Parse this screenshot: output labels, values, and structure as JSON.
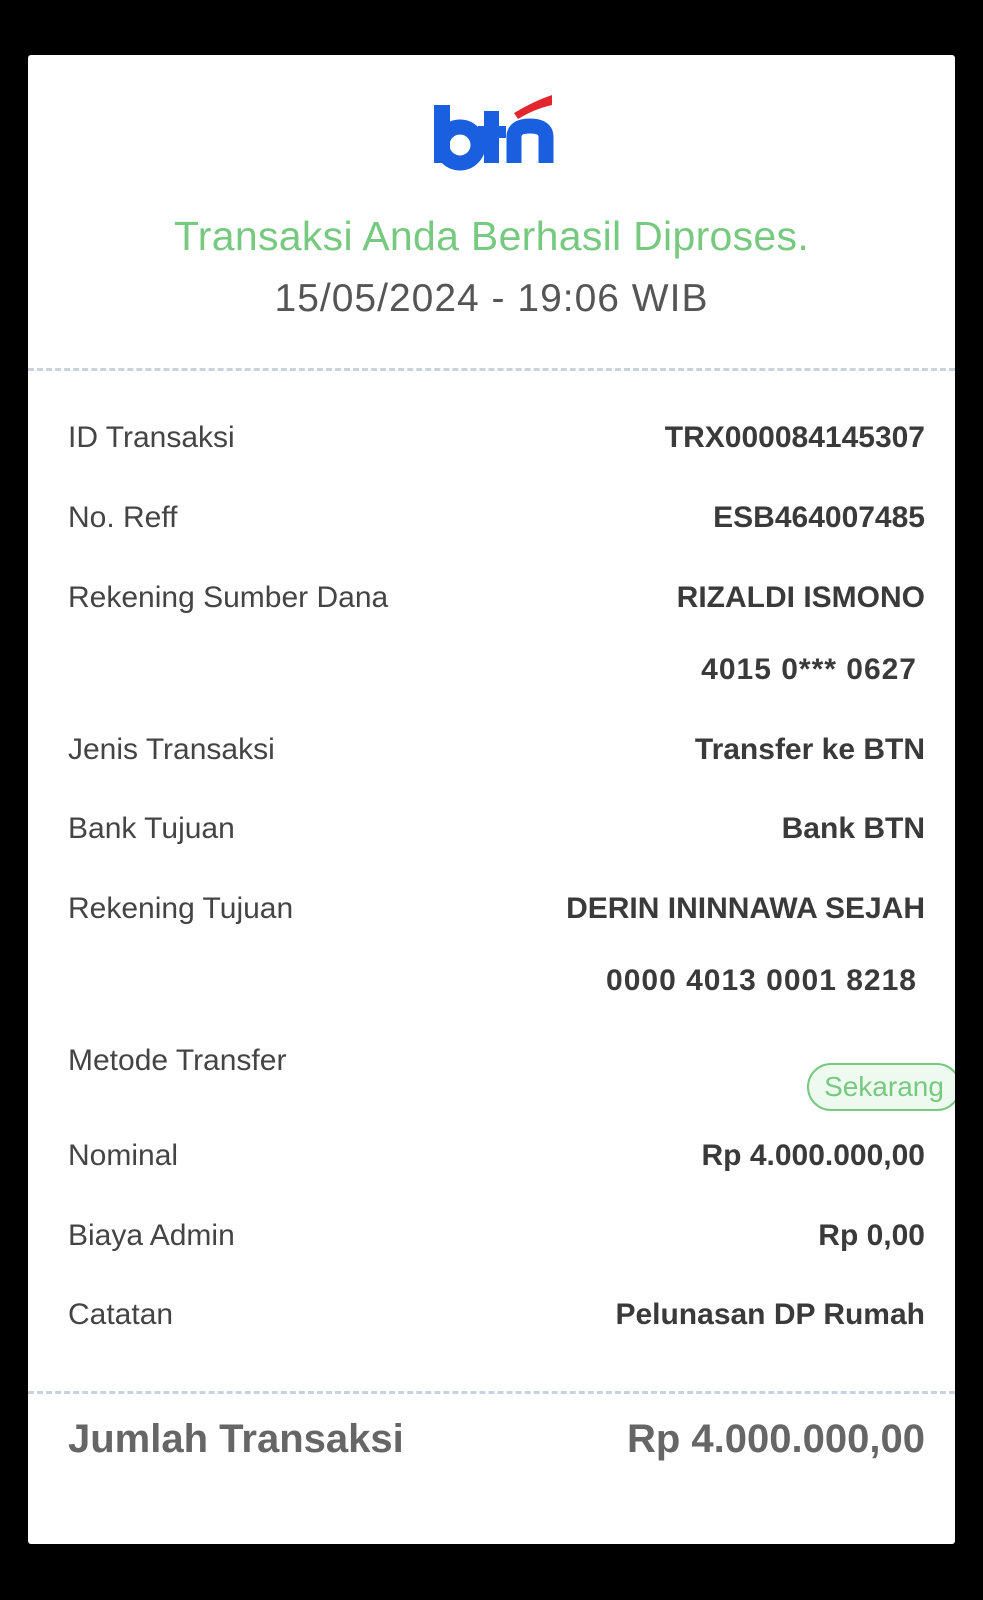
{
  "logo": {
    "text": "btn",
    "primary_color": "#1a5fe0",
    "accent_color": "#e3262e"
  },
  "header": {
    "title": "Transaksi Anda Berhasil Diproses.",
    "datetime": "15/05/2024 - 19:06 WIB"
  },
  "details": {
    "id_transaksi": {
      "label": "ID Transaksi",
      "value": "TRX000084145307"
    },
    "no_reff": {
      "label": "No. Reff",
      "value": "ESB464007485"
    },
    "rekening_sumber": {
      "label": "Rekening Sumber Dana",
      "name": "RIZALDI ISMONO",
      "number": "4015 0*** 0627"
    },
    "jenis_transaksi": {
      "label": "Jenis Transaksi",
      "value": "Transfer ke BTN"
    },
    "bank_tujuan": {
      "label": "Bank Tujuan",
      "value": "Bank BTN"
    },
    "rekening_tujuan": {
      "label": "Rekening Tujuan",
      "name": "DERIN ININNAWA SEJAH",
      "number": "0000 4013 0001 8218"
    },
    "metode_transfer": {
      "label": "Metode Transfer",
      "value": "Sekarang"
    },
    "nominal": {
      "label": "Nominal",
      "value": "Rp 4.000.000,00"
    },
    "biaya_admin": {
      "label": "Biaya Admin",
      "value": "Rp 0,00"
    },
    "catatan": {
      "label": "Catatan",
      "value": "Pelunasan DP Rumah"
    }
  },
  "total": {
    "label": "Jumlah Transaksi",
    "value": "Rp 4.000.000,00"
  },
  "colors": {
    "success_green": "#77c97f",
    "divider": "#c9d3e0"
  }
}
